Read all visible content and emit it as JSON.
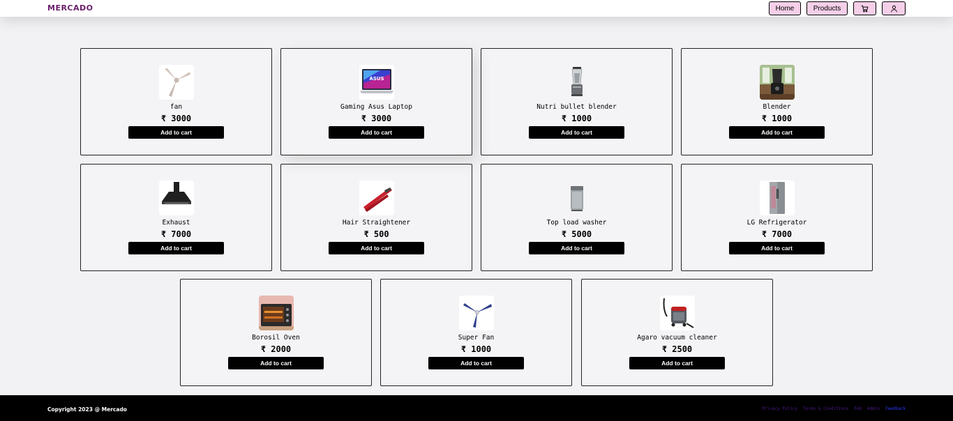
{
  "header": {
    "brand": "MERCADO",
    "nav": {
      "home": "Home",
      "products": "Products"
    },
    "icons": {
      "cart": "cart-icon",
      "user": "user-icon"
    }
  },
  "products": [
    {
      "name": "fan",
      "price": "₹ 3000",
      "image": "ceiling-fan",
      "button": "Add to cart"
    },
    {
      "name": "Gaming Asus Laptop",
      "price": "₹ 3000",
      "image": "laptop",
      "image_text": "ASUS",
      "button": "Add to cart"
    },
    {
      "name": "Nutri bullet blender",
      "price": "₹ 1000",
      "image": "blender",
      "button": "Add to cart"
    },
    {
      "name": "Blender",
      "price": "₹ 1000",
      "image": "blender-photo",
      "button": "Add to cart"
    },
    {
      "name": "Exhaust",
      "price": "₹ 7000",
      "image": "chimney-hood",
      "button": "Add to cart"
    },
    {
      "name": "Hair Straightener",
      "price": "₹ 500",
      "image": "hair-straightener",
      "button": "Add to cart"
    },
    {
      "name": "Top load washer",
      "price": "₹ 5000",
      "image": "washing-machine",
      "button": "Add to cart"
    },
    {
      "name": "LG Refrigerator",
      "price": "₹ 7000",
      "image": "refrigerator",
      "button": "Add to cart"
    },
    {
      "name": "Borosil Oven",
      "price": "₹ 2000",
      "image": "oven",
      "button": "Add to cart"
    },
    {
      "name": "Super Fan",
      "price": "₹ 1000",
      "image": "ceiling-fan-blue",
      "button": "Add to cart"
    },
    {
      "name": "Agaro vacuum cleaner",
      "price": "₹ 2500",
      "image": "vacuum-cleaner",
      "button": "Add to cart"
    }
  ],
  "footer": {
    "copyright": "Copyright 2023 @ Mercado",
    "links": [
      "Privacy Policy",
      "Terms & Conditions",
      "FAQ",
      "Admin",
      "Feedback"
    ]
  },
  "colors": {
    "brand": "#6b1f6b",
    "nav_button_bg": "#f5cfe8",
    "page_bg": "#f2f2f4",
    "footer_bg": "#000000",
    "footer_link": "#4b1a8a",
    "footer_link_active": "#2a38ff"
  }
}
